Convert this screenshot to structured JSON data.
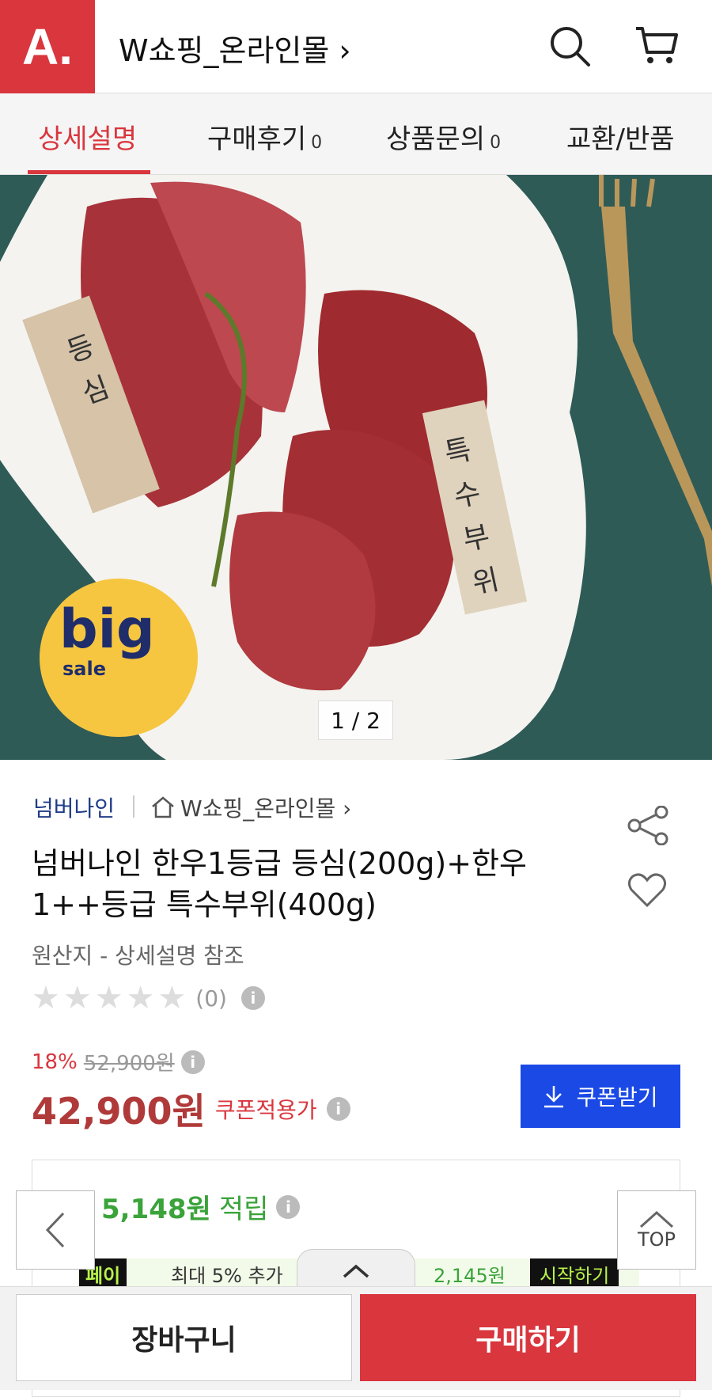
{
  "header": {
    "logo": "A.",
    "store_title": "W쇼핑_온라인몰 ›",
    "icons": [
      "search-icon",
      "cart-icon"
    ]
  },
  "tabs": [
    {
      "label": "상세설명",
      "count": ""
    },
    {
      "label": "구매후기",
      "count": "0"
    },
    {
      "label": "상품문의",
      "count": "0"
    },
    {
      "label": "교환/반품",
      "count": ""
    }
  ],
  "hero": {
    "tag_left": "등심",
    "tag_right": "특수부위",
    "badge_big": "big",
    "badge_sale": "sale",
    "pager": "1 / 2"
  },
  "product": {
    "brand": "넘버나인",
    "store": "W쇼핑_온라인몰 ›",
    "title": "넘버나인 한우1등급 등심(200g)+한우1++등급 특수부위(400g)",
    "origin": "원산지 - 상세설명 참조",
    "rating_count": "(0)",
    "discount_pct": "18%",
    "original_price": "52,900원",
    "price": "42,900원",
    "price_note": "쿠폰적용가",
    "coupon_label": "쿠폰받기",
    "points_amount": "5,148원",
    "points_label": "적립",
    "promo_badge": "페이",
    "promo_text": "최대 5% 추가",
    "promo_amount": "2,145원",
    "promo_start": "시작하기"
  },
  "floating": {
    "top_label": "TOP"
  },
  "bottom": {
    "cart_label": "장바구니",
    "buy_label": "구매하기"
  },
  "colors": {
    "brand_red": "#d9363e",
    "coupon_blue": "#1a49e5",
    "points_green": "#3aa33a"
  }
}
